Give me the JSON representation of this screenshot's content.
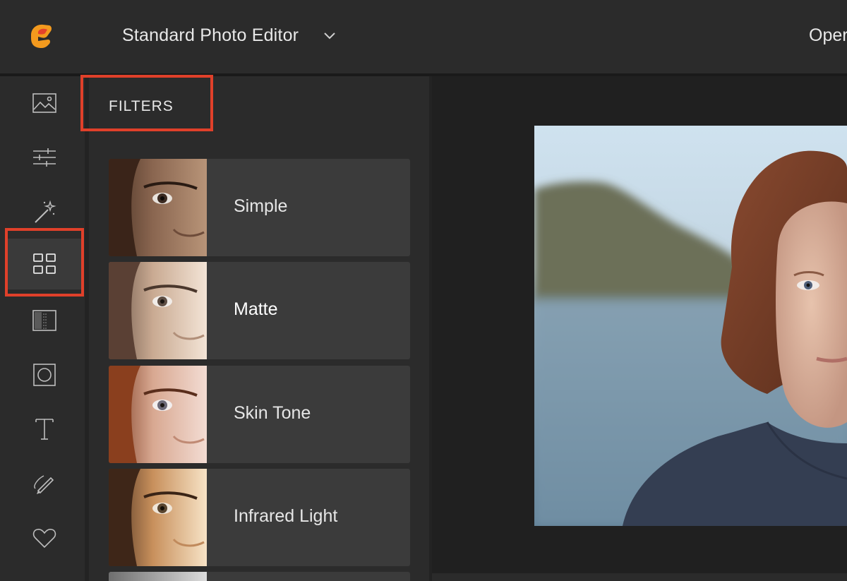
{
  "header": {
    "app_title": "Standard Photo Editor",
    "open_label": "Oper",
    "logo": "app-logo"
  },
  "toolrail": {
    "items": [
      {
        "icon": "image-icon"
      },
      {
        "icon": "sliders-icon"
      },
      {
        "icon": "magic-wand-icon"
      },
      {
        "icon": "grid-icon",
        "active": true
      },
      {
        "icon": "texture-icon"
      },
      {
        "icon": "frame-icon"
      },
      {
        "icon": "text-icon"
      },
      {
        "icon": "brush-icon"
      },
      {
        "icon": "heart-icon"
      }
    ]
  },
  "panel": {
    "title": "FILTERS",
    "filters": [
      {
        "label": "Simple"
      },
      {
        "label": "Matte",
        "selected": true
      },
      {
        "label": "Skin Tone"
      },
      {
        "label": "Infrared Light"
      }
    ]
  },
  "colors": {
    "highlight": "#e0402a",
    "accent_orange": "#f08a1c",
    "background": "#2b2b2b"
  }
}
